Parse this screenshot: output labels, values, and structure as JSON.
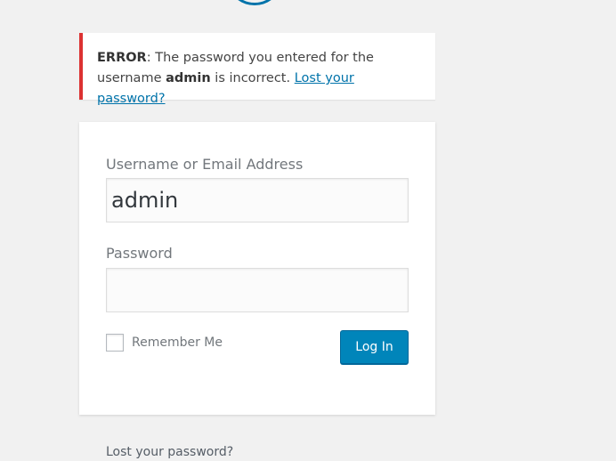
{
  "error_notice": {
    "error_label": "ERROR",
    "text_1": ": The password you entered for the username ",
    "username": "admin",
    "text_2": " is incorrect. ",
    "lost_link": "Lost your password?"
  },
  "login_form": {
    "username_label": "Username or Email Address",
    "username_value": "admin",
    "password_label": "Password",
    "password_value": "",
    "remember_label": "Remember Me",
    "remember_checked": false,
    "submit_label": "Log In"
  },
  "footer_links": {
    "lost_password": "Lost your password?"
  },
  "colors": {
    "background": "#f1f1f1",
    "error_border": "#dc3232",
    "primary": "#0085ba",
    "link": "#0073aa"
  }
}
